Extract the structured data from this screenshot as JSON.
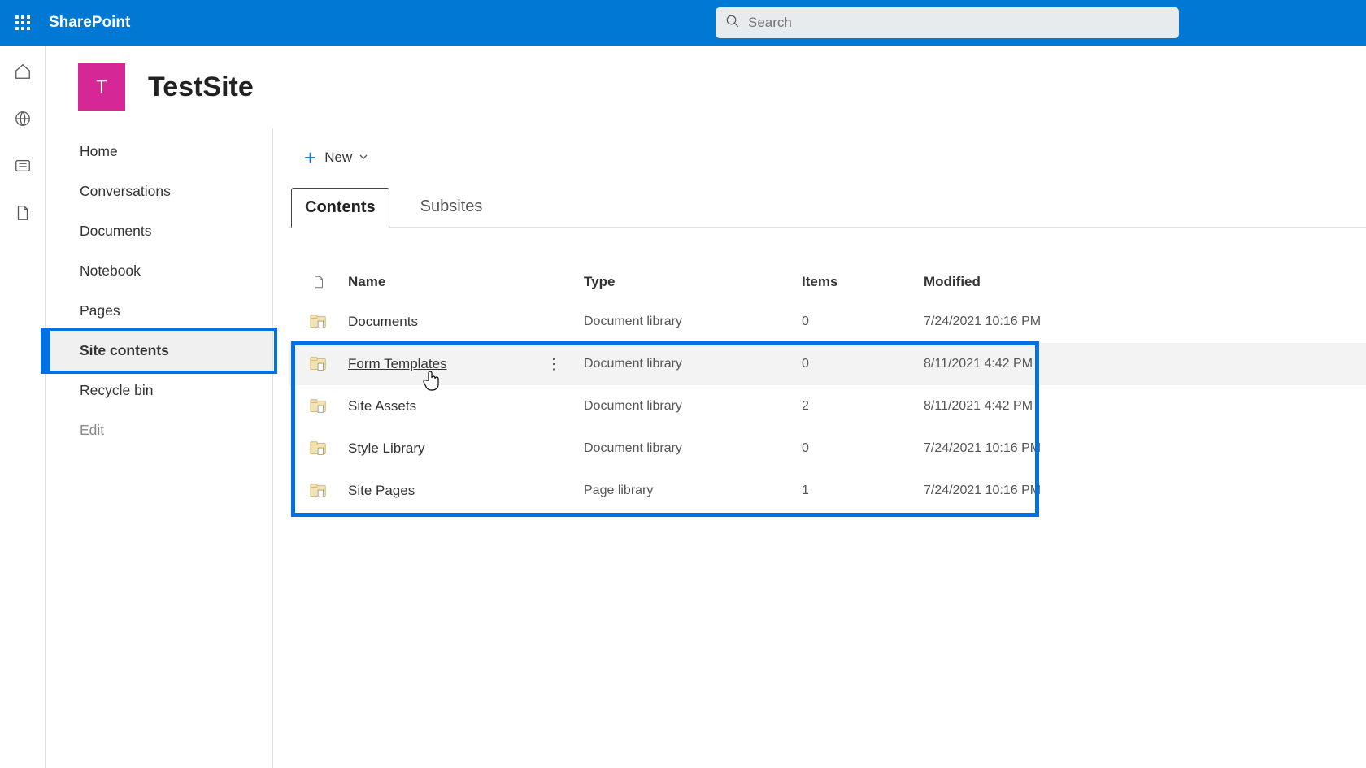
{
  "brand": "SharePoint",
  "search": {
    "placeholder": "Search"
  },
  "site": {
    "initial": "T",
    "title": "TestSite"
  },
  "leftnav": {
    "items": [
      {
        "label": "Home"
      },
      {
        "label": "Conversations"
      },
      {
        "label": "Documents"
      },
      {
        "label": "Notebook"
      },
      {
        "label": "Pages"
      },
      {
        "label": "Site contents",
        "selected": true
      },
      {
        "label": "Recycle bin"
      },
      {
        "label": "Edit",
        "muted": true
      }
    ]
  },
  "commands": {
    "new": "New"
  },
  "tabs": {
    "contents": "Contents",
    "subsites": "Subsites"
  },
  "columns": {
    "name": "Name",
    "type": "Type",
    "items": "Items",
    "modified": "Modified"
  },
  "rows": [
    {
      "name": "Documents",
      "type": "Document library",
      "items": "0",
      "modified": "7/24/2021 10:16 PM"
    },
    {
      "name": "Form Templates",
      "type": "Document library",
      "items": "0",
      "modified": "8/11/2021 4:42 PM"
    },
    {
      "name": "Site Assets",
      "type": "Document library",
      "items": "2",
      "modified": "8/11/2021 4:42 PM"
    },
    {
      "name": "Style Library",
      "type": "Document library",
      "items": "0",
      "modified": "7/24/2021 10:16 PM"
    },
    {
      "name": "Site Pages",
      "type": "Page library",
      "items": "1",
      "modified": "7/24/2021 10:16 PM"
    }
  ]
}
